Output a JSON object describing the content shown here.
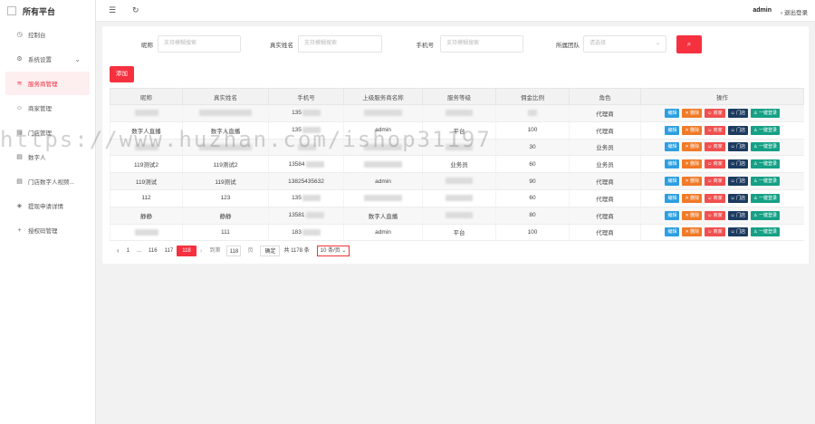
{
  "brand": {
    "title": "所有平台"
  },
  "sidebar": {
    "items": [
      {
        "label": "控制台",
        "icon": "dashboard-icon"
      },
      {
        "label": "系统设置",
        "icon": "gear-icon",
        "expandable": true
      },
      {
        "label": "服务商管理",
        "icon": "wifi-icon",
        "active": true
      },
      {
        "label": "商家管理",
        "icon": "smile-icon"
      },
      {
        "label": "门店管理",
        "icon": "store-icon"
      },
      {
        "label": "数字人",
        "icon": "store-icon"
      },
      {
        "label": "门店数字人视频...",
        "icon": "store-icon"
      },
      {
        "label": "提现申请详情",
        "icon": "layers-icon"
      },
      {
        "label": "授权码管理",
        "icon": "plus-icon"
      }
    ]
  },
  "topbar": {
    "user": "admin",
    "logout": "退出登录"
  },
  "filters": {
    "nickname": {
      "label": "昵称",
      "placeholder": "支持模糊搜索"
    },
    "realname": {
      "label": "真实姓名",
      "placeholder": "支持模糊搜索"
    },
    "phone": {
      "label": "手机号",
      "placeholder": "支持模糊搜索"
    },
    "team": {
      "label": "所属团队",
      "placeholder": "请选择"
    }
  },
  "add_button": "添加",
  "table": {
    "headers": [
      "昵称",
      "真实姓名",
      "手机号",
      "上级服务商名称",
      "服务等级",
      "佣金比例",
      "角色",
      "操作"
    ],
    "rows": [
      {
        "nickname": "",
        "realname": "",
        "phone": "135",
        "parent": "",
        "level": "",
        "ratio": "",
        "role": "代理商"
      },
      {
        "nickname": "数字人直播",
        "realname": "数字人直播",
        "phone": "135",
        "parent": "admin",
        "level": "平台",
        "ratio": "100",
        "role": "代理商"
      },
      {
        "nickname": "",
        "realname": "",
        "phone": "",
        "parent": "",
        "level": "",
        "ratio": "30",
        "role": "业务员"
      },
      {
        "nickname": "119测试2",
        "realname": "119测试2",
        "phone": "13584",
        "parent": "",
        "level": "业务员",
        "ratio": "60",
        "role": "业务员"
      },
      {
        "nickname": "119测试",
        "realname": "119测试",
        "phone": "13825435632",
        "parent": "admin",
        "level": "",
        "ratio": "90",
        "role": "代理商"
      },
      {
        "nickname": "112",
        "realname": "123",
        "phone": "135",
        "parent": "",
        "level": "",
        "ratio": "60",
        "role": "代理商"
      },
      {
        "nickname": "静静",
        "realname": "静静",
        "phone": "13581",
        "parent": "数字人直播",
        "level": "",
        "ratio": "80",
        "role": "代理商"
      },
      {
        "nickname": "",
        "realname": "111",
        "phone": "183",
        "parent": "admin",
        "level": "平台",
        "ratio": "100",
        "role": "代理商"
      }
    ],
    "ops": {
      "edit": "编辑",
      "delete": "删除",
      "merchant": "商家",
      "store": "门店",
      "login": "一键登录"
    }
  },
  "pagination": {
    "pages": [
      "1",
      "...",
      "116",
      "117",
      "118"
    ],
    "current": "118",
    "goto_label": "到第",
    "goto_value": "118",
    "page_unit": "页",
    "confirm": "确定",
    "total": "共 1178 条",
    "page_size": "10 条/页"
  },
  "watermark": "https://www.huzhan.com/ishop31197"
}
